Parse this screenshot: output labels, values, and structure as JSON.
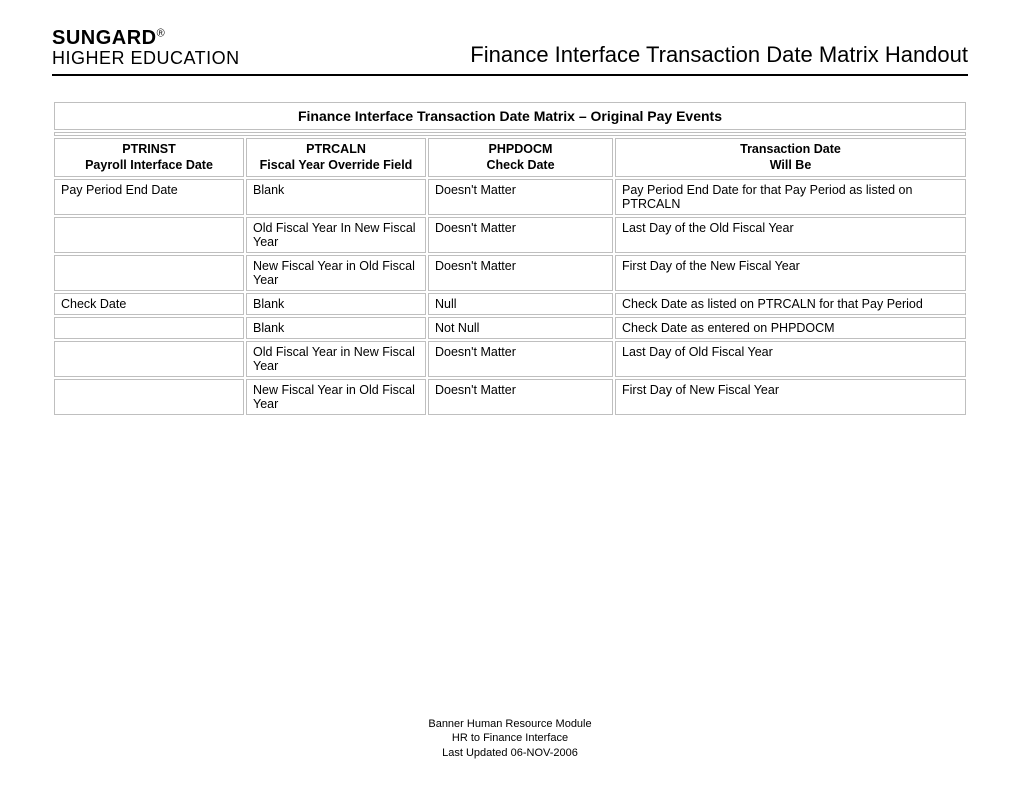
{
  "logo": {
    "top": "SUNGARD",
    "reg": "®",
    "bottom": "HIGHER EDUCATION"
  },
  "doc_title": "Finance Interface Transaction Date Matrix Handout",
  "table": {
    "title": "Finance Interface Transaction Date Matrix – Original Pay Events",
    "headers": [
      {
        "line1": "PTRINST",
        "line2": "Payroll Interface Date"
      },
      {
        "line1": "PTRCALN",
        "line2": "Fiscal Year Override Field"
      },
      {
        "line1": "PHPDOCM",
        "line2": "Check Date"
      },
      {
        "line1": "Transaction Date",
        "line2": "Will Be"
      }
    ],
    "rows": [
      {
        "c1": "Pay Period End Date",
        "c2": "Blank",
        "c3": "Doesn't Matter",
        "c4": "Pay Period End Date for that Pay Period as listed on PTRCALN"
      },
      {
        "c1": "",
        "c2": "Old Fiscal Year In New Fiscal Year",
        "c3": "Doesn't Matter",
        "c4": "Last Day of the Old Fiscal Year"
      },
      {
        "c1": "",
        "c2": "New Fiscal Year in Old Fiscal Year",
        "c3": "Doesn't Matter",
        "c4": "First Day of the New Fiscal Year"
      },
      {
        "c1": "Check Date",
        "c2": "Blank",
        "c3": "Null",
        "c4": "Check Date as listed on PTRCALN for that Pay Period"
      },
      {
        "c1": "",
        "c2": "Blank",
        "c3": "Not Null",
        "c4": "Check Date as entered on PHPDOCM"
      },
      {
        "c1": "",
        "c2": "Old Fiscal Year in New Fiscal Year",
        "c3": "Doesn't Matter",
        "c4": "Last Day of Old Fiscal Year"
      },
      {
        "c1": "",
        "c2": "New Fiscal Year in Old Fiscal Year",
        "c3": "Doesn't Matter",
        "c4": "First Day of New Fiscal Year"
      }
    ]
  },
  "footer": {
    "line1": "Banner Human Resource Module",
    "line2": "HR to Finance Interface",
    "line3": "Last Updated 06-NOV-2006"
  }
}
